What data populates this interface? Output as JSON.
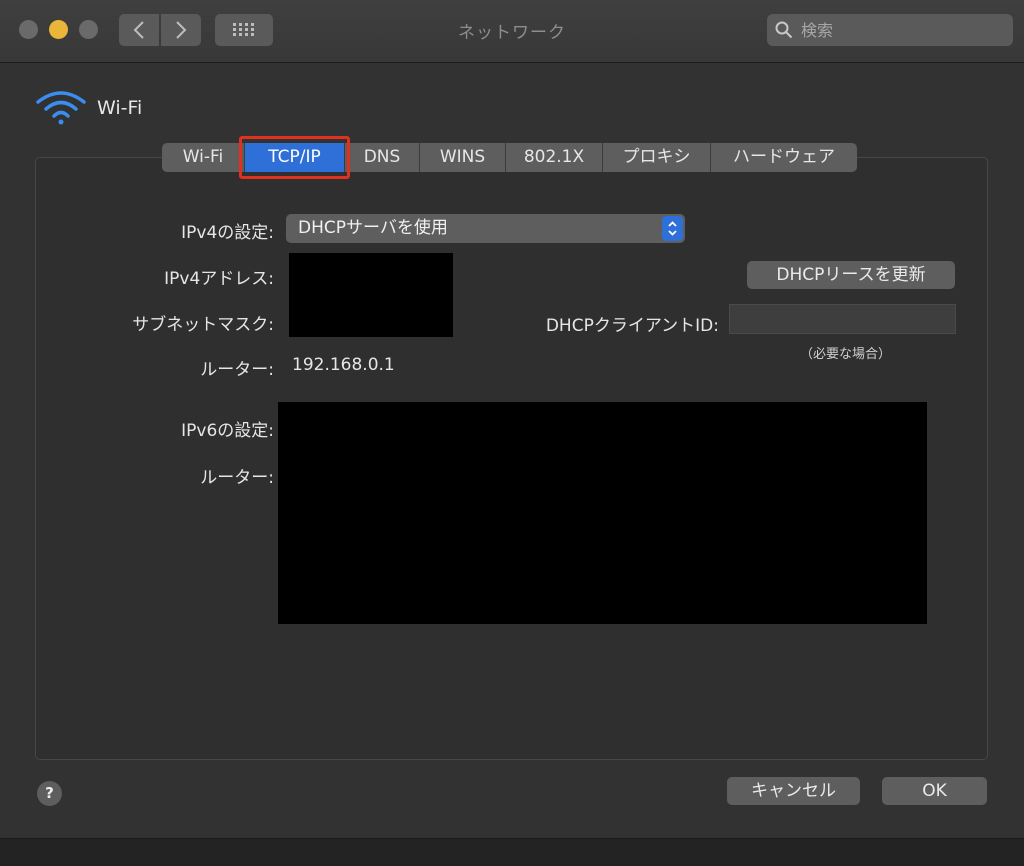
{
  "window": {
    "title": "ネットワーク",
    "search_placeholder": "検索"
  },
  "header": {
    "service_name": "Wi-Fi"
  },
  "tabs": [
    {
      "label": "Wi-Fi",
      "active": false
    },
    {
      "label": "TCP/IP",
      "active": true
    },
    {
      "label": "DNS",
      "active": false
    },
    {
      "label": "WINS",
      "active": false
    },
    {
      "label": "802.1X",
      "active": false
    },
    {
      "label": "プロキシ",
      "active": false
    },
    {
      "label": "ハードウェア",
      "active": false
    }
  ],
  "ipv4": {
    "config_label": "IPv4の設定:",
    "config_value": "DHCPサーバを使用",
    "address_label": "IPv4アドレス:",
    "subnet_label": "サブネットマスク:",
    "router_label": "ルーター:",
    "router_value": "192.168.0.1"
  },
  "dhcp": {
    "renew_button": "DHCPリースを更新",
    "client_id_label": "DHCPクライアントID:",
    "client_id_value": "",
    "client_id_hint": "（必要な場合）"
  },
  "ipv6": {
    "config_label": "IPv6の設定:",
    "router_label": "ルーター:"
  },
  "footer": {
    "help": "?",
    "cancel_button": "キャンセル",
    "ok_button": "OK"
  },
  "colors": {
    "accent": "#2f6fd8",
    "highlight_box": "#e0301e",
    "minimize_light": "#e9b63a",
    "wifi_icon": "#3a8ef0"
  }
}
